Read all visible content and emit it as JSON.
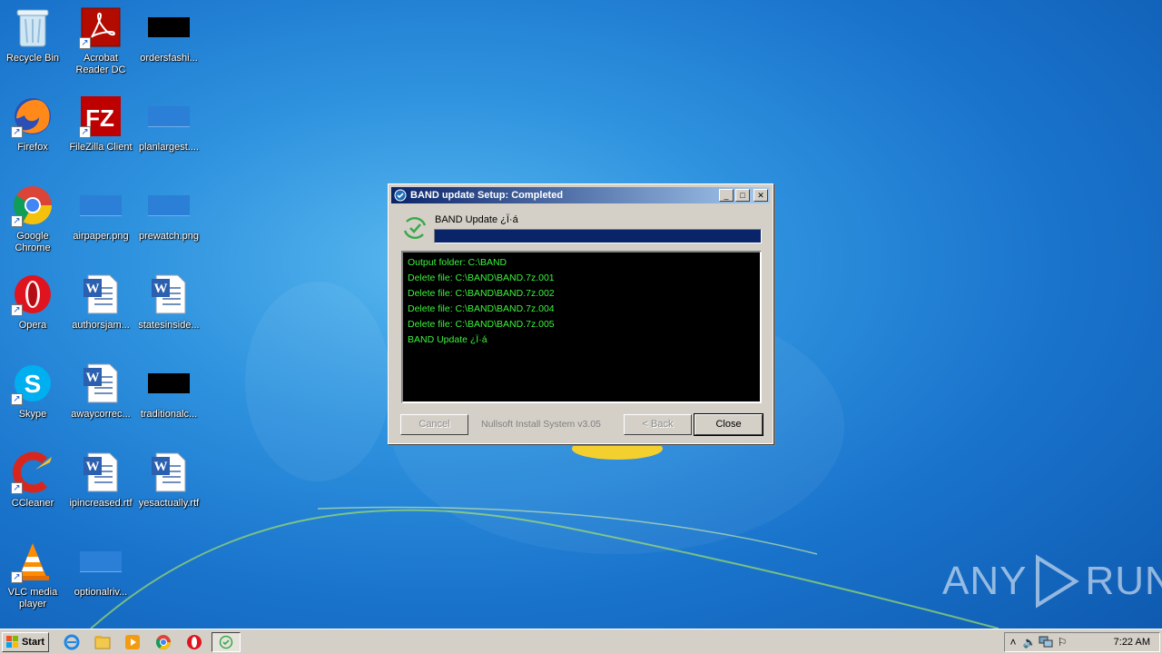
{
  "desktop": {
    "icons": [
      {
        "label": "Recycle Bin"
      },
      {
        "label": "Acrobat Reader DC"
      },
      {
        "label": "ordersfashi..."
      },
      {
        "label": "Firefox"
      },
      {
        "label": "FileZilla Client"
      },
      {
        "label": "planlargest...."
      },
      {
        "label": "Google Chrome"
      },
      {
        "label": "airpaper.png"
      },
      {
        "label": "prewatch.png"
      },
      {
        "label": "Opera"
      },
      {
        "label": "authorsjam..."
      },
      {
        "label": "statesinside..."
      },
      {
        "label": "Skype"
      },
      {
        "label": "awaycorrec..."
      },
      {
        "label": "traditionalc..."
      },
      {
        "label": "CCleaner"
      },
      {
        "label": "ipincreased.rtf"
      },
      {
        "label": "yesactually.rtf"
      },
      {
        "label": "VLC media player"
      },
      {
        "label": "optionalriv..."
      }
    ]
  },
  "dialog": {
    "title": "BAND update Setup: Completed",
    "header": "BAND Update ¿Ï·á",
    "progress_fraction": 1.0,
    "log": [
      "Output folder: C:\\BAND",
      "Delete file: C:\\BAND\\BAND.7z.001",
      "Delete file: C:\\BAND\\BAND.7z.002",
      "Delete file: C:\\BAND\\BAND.7z.004",
      "Delete file: C:\\BAND\\BAND.7z.005",
      " BAND Update ¿Ï·á"
    ],
    "branding": "Nullsoft Install System v3.05",
    "buttons": {
      "cancel": "Cancel",
      "back": "< Back",
      "close": "Close"
    }
  },
  "watermark": {
    "left": "ANY",
    "right": "RUN"
  },
  "taskbar": {
    "start_label": "Start",
    "clock": "7:22 AM"
  },
  "colors": {
    "title_gradient_start": "#0a246a",
    "log_text": "#3cf43c",
    "progress_fill": "#0a246a"
  }
}
